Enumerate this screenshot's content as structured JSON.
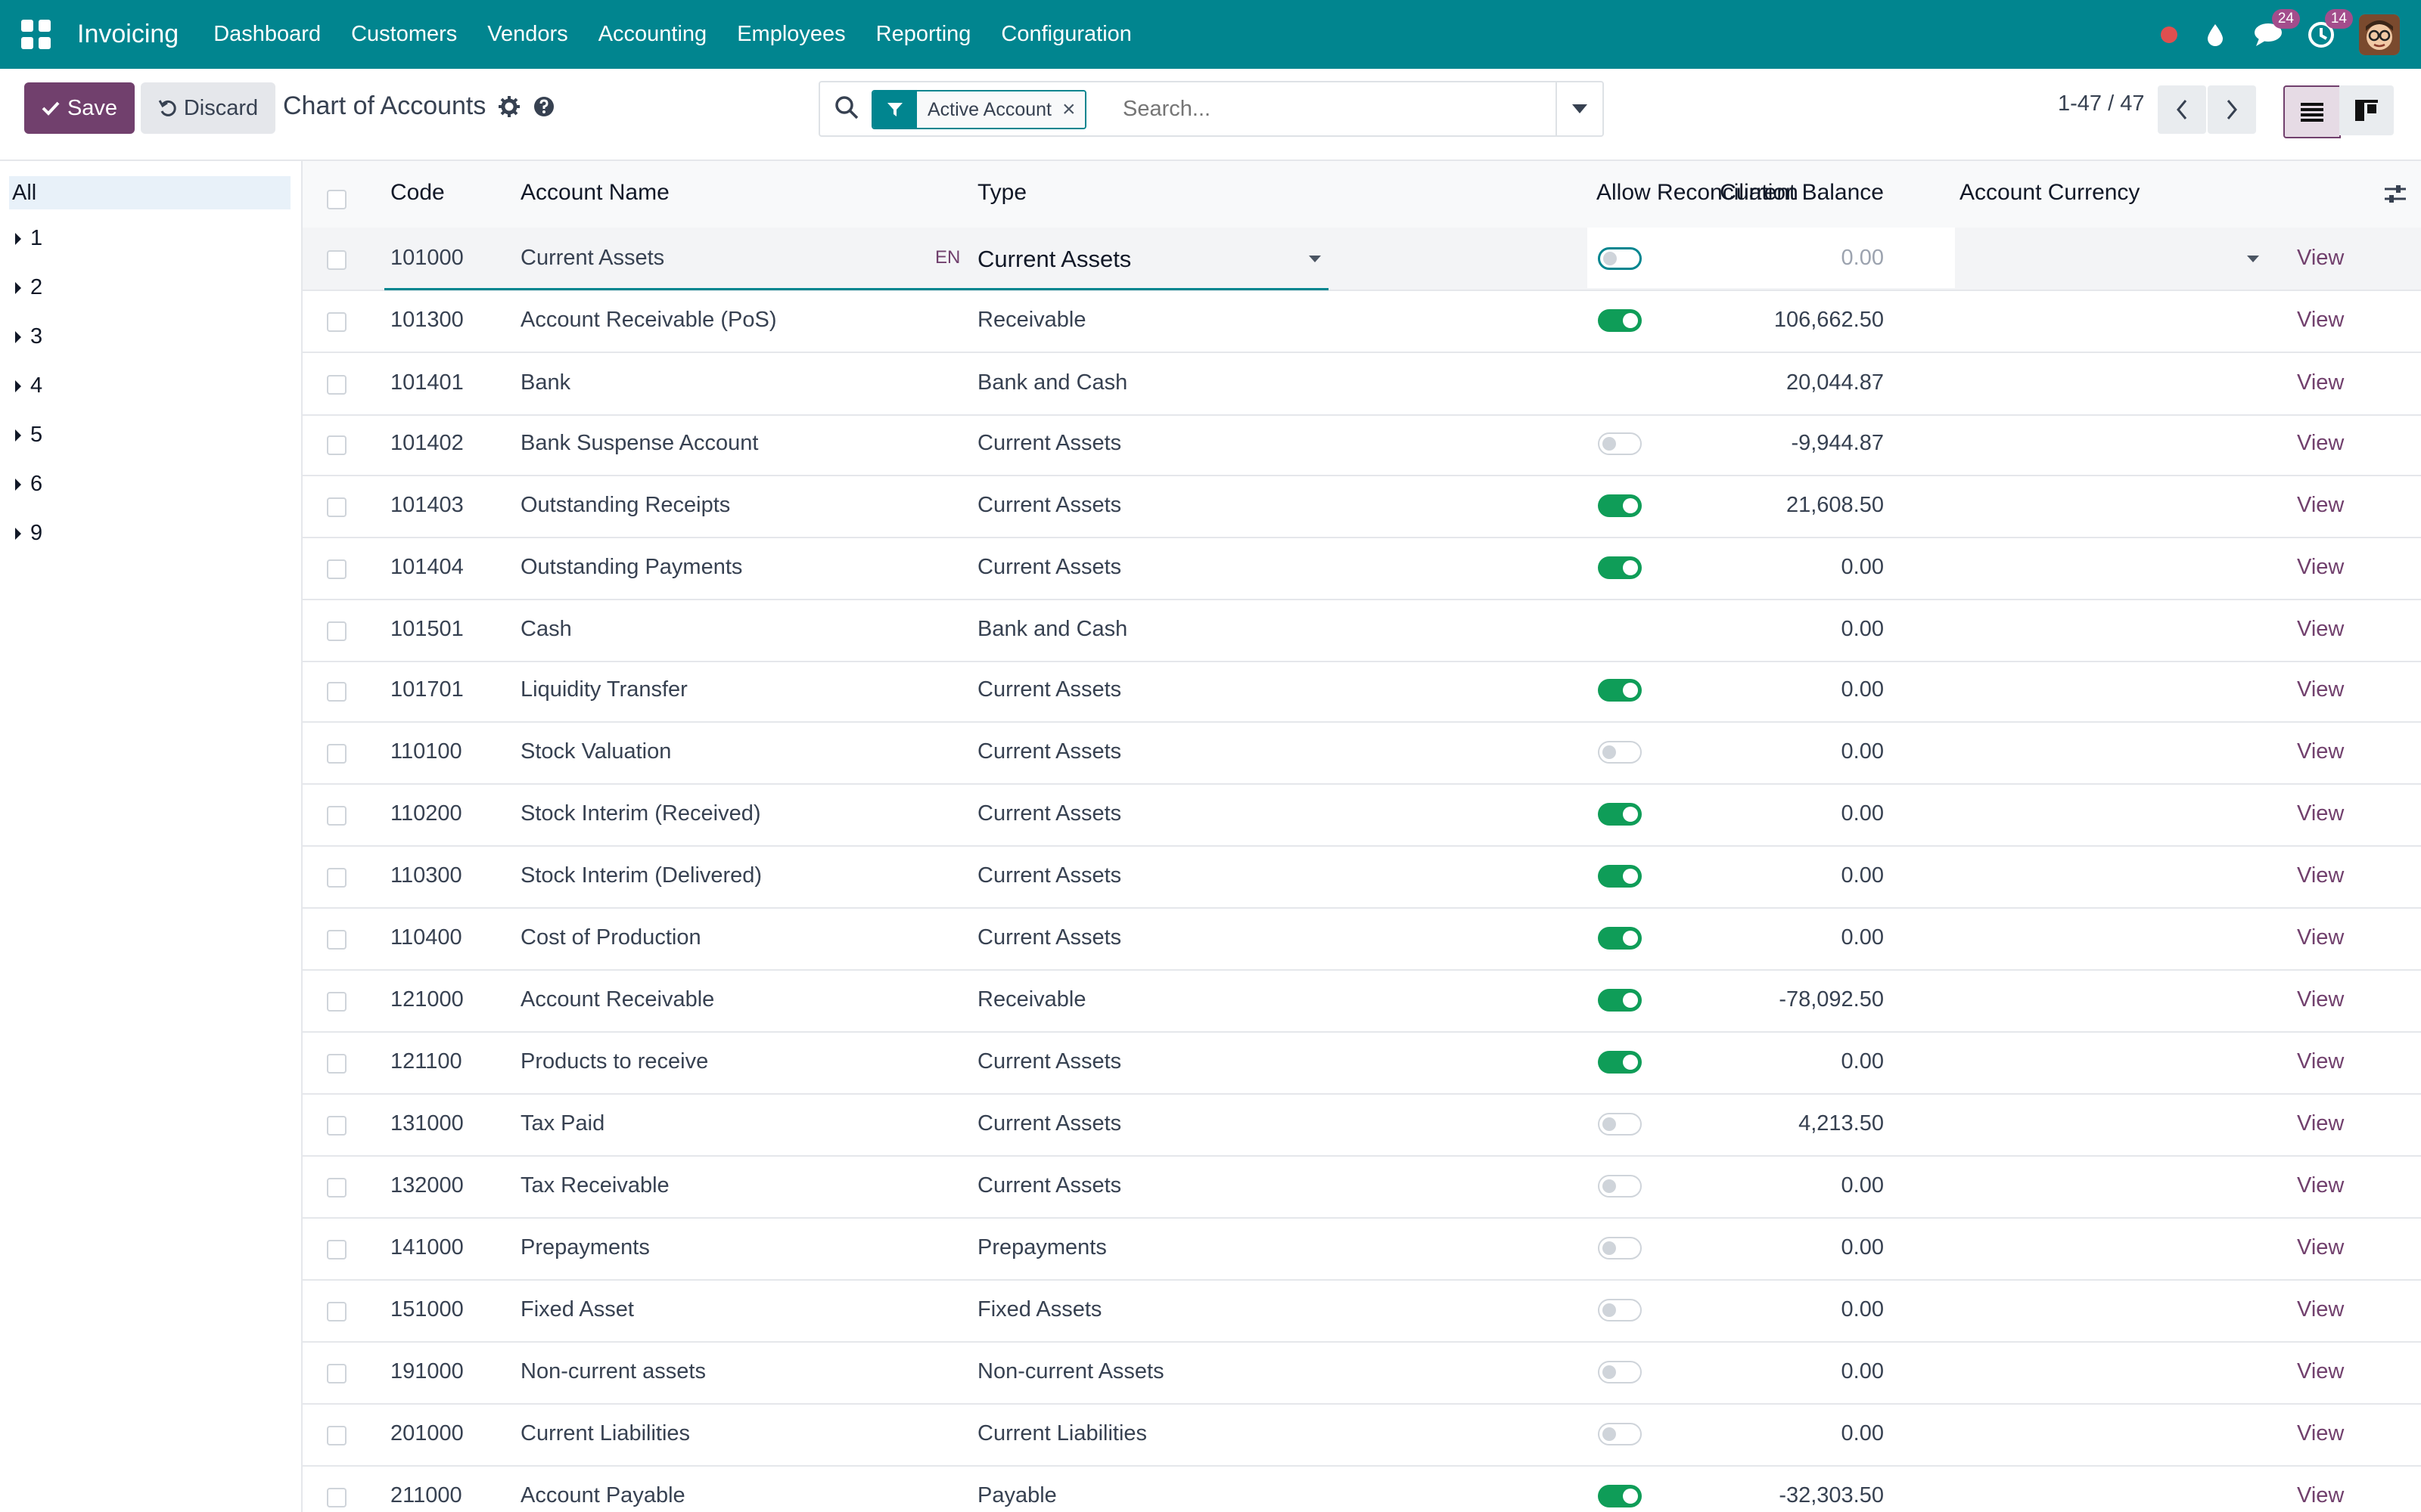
{
  "navbar": {
    "brand": "Invoicing",
    "menu": [
      "Dashboard",
      "Customers",
      "Vendors",
      "Accounting",
      "Employees",
      "Reporting",
      "Configuration"
    ],
    "messages_count": "24",
    "activities_count": "14",
    "color": "#01858f"
  },
  "control": {
    "save_label": "Save",
    "discard_label": "Discard",
    "title": "Chart of Accounts",
    "facet_label": "Active Account",
    "search_placeholder": "Search...",
    "pager": "1-47 / 47"
  },
  "sidepanel": {
    "all_label": "All",
    "groups": [
      "1",
      "2",
      "3",
      "4",
      "5",
      "6",
      "9"
    ]
  },
  "table": {
    "headers": {
      "code": "Code",
      "name": "Account Name",
      "type": "Type",
      "balance": "Current Balance",
      "reconcile": "Allow Reconciliation",
      "currency": "Account Currency"
    },
    "lang_badge": "EN",
    "view_label": "View",
    "rows": [
      {
        "code": "101000",
        "name": "Current Assets",
        "type": "Current Assets",
        "balance": "0.00",
        "reconcile": "off",
        "editing": true
      },
      {
        "code": "101300",
        "name": "Account Receivable (PoS)",
        "type": "Receivable",
        "balance": "106,662.50",
        "reconcile": "on"
      },
      {
        "code": "101401",
        "name": "Bank",
        "type": "Bank and Cash",
        "balance": "20,044.87",
        "reconcile": "none"
      },
      {
        "code": "101402",
        "name": "Bank Suspense Account",
        "type": "Current Assets",
        "balance": "-9,944.87",
        "reconcile": "off"
      },
      {
        "code": "101403",
        "name": "Outstanding Receipts",
        "type": "Current Assets",
        "balance": "21,608.50",
        "reconcile": "on"
      },
      {
        "code": "101404",
        "name": "Outstanding Payments",
        "type": "Current Assets",
        "balance": "0.00",
        "reconcile": "on"
      },
      {
        "code": "101501",
        "name": "Cash",
        "type": "Bank and Cash",
        "balance": "0.00",
        "reconcile": "none"
      },
      {
        "code": "101701",
        "name": "Liquidity Transfer",
        "type": "Current Assets",
        "balance": "0.00",
        "reconcile": "on"
      },
      {
        "code": "110100",
        "name": "Stock Valuation",
        "type": "Current Assets",
        "balance": "0.00",
        "reconcile": "off"
      },
      {
        "code": "110200",
        "name": "Stock Interim (Received)",
        "type": "Current Assets",
        "balance": "0.00",
        "reconcile": "on"
      },
      {
        "code": "110300",
        "name": "Stock Interim (Delivered)",
        "type": "Current Assets",
        "balance": "0.00",
        "reconcile": "on"
      },
      {
        "code": "110400",
        "name": "Cost of Production",
        "type": "Current Assets",
        "balance": "0.00",
        "reconcile": "on"
      },
      {
        "code": "121000",
        "name": "Account Receivable",
        "type": "Receivable",
        "balance": "-78,092.50",
        "reconcile": "on"
      },
      {
        "code": "121100",
        "name": "Products to receive",
        "type": "Current Assets",
        "balance": "0.00",
        "reconcile": "on"
      },
      {
        "code": "131000",
        "name": "Tax Paid",
        "type": "Current Assets",
        "balance": "4,213.50",
        "reconcile": "off"
      },
      {
        "code": "132000",
        "name": "Tax Receivable",
        "type": "Current Assets",
        "balance": "0.00",
        "reconcile": "off"
      },
      {
        "code": "141000",
        "name": "Prepayments",
        "type": "Prepayments",
        "balance": "0.00",
        "reconcile": "off"
      },
      {
        "code": "151000",
        "name": "Fixed Asset",
        "type": "Fixed Assets",
        "balance": "0.00",
        "reconcile": "off"
      },
      {
        "code": "191000",
        "name": "Non-current assets",
        "type": "Non-current Assets",
        "balance": "0.00",
        "reconcile": "off"
      },
      {
        "code": "201000",
        "name": "Current Liabilities",
        "type": "Current Liabilities",
        "balance": "0.00",
        "reconcile": "off"
      },
      {
        "code": "211000",
        "name": "Account Payable",
        "type": "Payable",
        "balance": "-32,303.50",
        "reconcile": "on"
      }
    ]
  }
}
